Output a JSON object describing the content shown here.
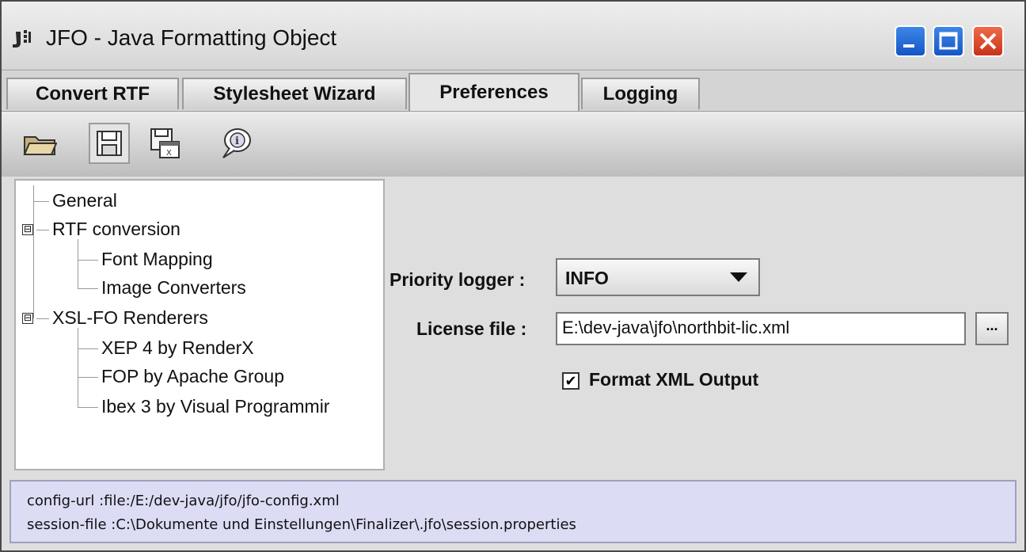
{
  "window": {
    "title": "JFO - Java Formatting Object",
    "controls": [
      "minimize",
      "maximize",
      "close"
    ]
  },
  "tabs": [
    {
      "label": "Convert RTF",
      "active": false
    },
    {
      "label": "Stylesheet Wizard",
      "active": false
    },
    {
      "label": "Preferences",
      "active": true
    },
    {
      "label": "Logging",
      "active": false
    }
  ],
  "toolbar": {
    "buttons": [
      "open-folder-icon",
      "save-icon",
      "save-as-icon",
      "info-icon"
    ]
  },
  "tree": {
    "items": [
      {
        "label": "General"
      },
      {
        "label": "RTF conversion",
        "expander": "⊟"
      },
      {
        "label": "Font Mapping"
      },
      {
        "label": "Image Converters"
      },
      {
        "label": "XSL-FO Renderers",
        "expander": "⊟"
      },
      {
        "label": "XEP 4 by RenderX"
      },
      {
        "label": "FOP by Apache Group"
      },
      {
        "label": "Ibex 3 by Visual Programmir"
      }
    ]
  },
  "form": {
    "priority_logger_label": "Priority logger :",
    "priority_logger_value": "INFO",
    "license_file_label": "License file :",
    "license_file_value": "E:\\dev-java\\jfo\\northbit-lic.xml",
    "browse_label": "...",
    "format_xml_label": "Format XML Output",
    "format_xml_checked": true,
    "check_mark": "✔"
  },
  "status": {
    "config_url": "config-url   :file:/E:/dev-java/jfo/jfo-config.xml",
    "session_file": "session-file :C:\\Dokumente und Einstellungen\\Finalizer\\.jfo\\session.properties"
  }
}
